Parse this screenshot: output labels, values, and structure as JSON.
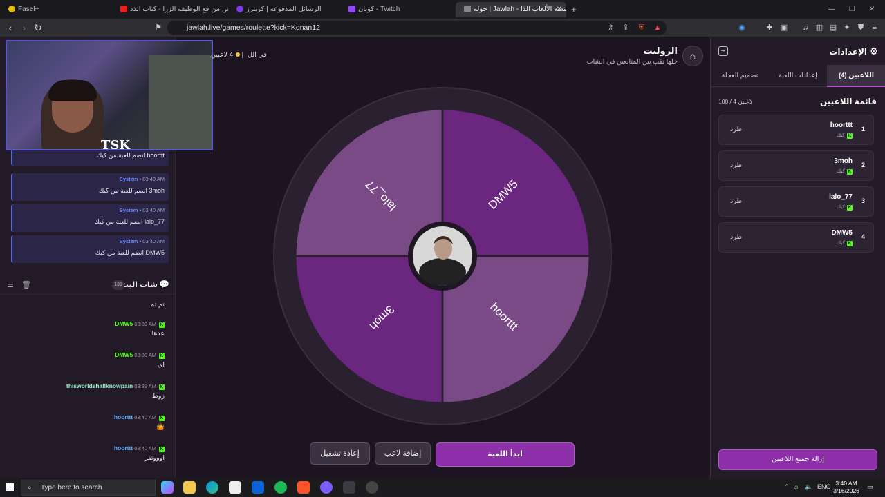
{
  "browser": {
    "tabs": [
      {
        "label": "Fasel+"
      },
      {
        "label": "تخلص من فع الوظيفة الزرا - كتاب الذد"
      },
      {
        "label": "الرسائل المدفوعة | كريترز"
      },
      {
        "label": "كونان - Twitch"
      },
      {
        "label": "جولة | Jawlah - منصة الألعاب الذا"
      }
    ],
    "new_tab": "+",
    "url": "jawlah.live/games/roulette?kick=Konan12"
  },
  "header": {
    "title": "الروليت",
    "subtitle": "خلها تقب بين المتابعين في الشات",
    "players_badge": "4 لاعبين",
    "players_badge_suffix": "في الل"
  },
  "wheel": {
    "segments": [
      {
        "name": "DMW5",
        "color": "#6b2680"
      },
      {
        "name": "hoorttt",
        "color": "#7a4a86"
      },
      {
        "name": "3moh",
        "color": "#6b2680"
      },
      {
        "name": "lalo_77",
        "color": "#7a4a86"
      }
    ]
  },
  "buttons": {
    "start": "ابدأ اللعبة",
    "add_player": "إضافة لاعب",
    "restart": "إعادة تشغيل"
  },
  "settings": {
    "title": "الإعدادات",
    "tabs": [
      "اللاعبين (4)",
      "إعدادات اللعبة",
      "تصميم العجلة"
    ],
    "list_title": "قائمة اللاعبين",
    "list_count": "100 / 4 لاعبين",
    "platform": "كيك",
    "kick_label": "طرد",
    "players": [
      {
        "num": "1",
        "name": "hoorttt"
      },
      {
        "num": "2",
        "name": "3moh"
      },
      {
        "num": "3",
        "name": "lalo_77"
      },
      {
        "num": "4",
        "name": "DMW5"
      }
    ],
    "remove_all": "إزالة جميع اللاعبين"
  },
  "chat": {
    "system_messages": [
      {
        "user": "",
        "time": "",
        "text": "hoorttt انضم للعبة من كيك"
      },
      {
        "user": "System",
        "time": "03:40 AM",
        "text": "3moh انضم للعبة من كيك"
      },
      {
        "user": "System",
        "time": "03:40 AM",
        "text": "lalo_77 انضم للعبة من كيك"
      },
      {
        "user": "System",
        "time": "03:40 AM",
        "text": "DMW5 انضم للعبة من كيك"
      }
    ],
    "title": "شات البث",
    "count": "131",
    "messages": [
      {
        "user": "",
        "time": "",
        "text": "تم تم",
        "color": "#53fc18"
      },
      {
        "user": "DMW5",
        "time": "03:39 AM",
        "text": "عدها",
        "color": "#53fc18"
      },
      {
        "user": "DMW5",
        "time": "03:39 AM",
        "text": "اي",
        "color": "#53fc18"
      },
      {
        "user": "thisworldshallknowpain",
        "time": "03:39 AM",
        "text": "زوط",
        "color": "#9be8c8"
      },
      {
        "user": "hoorttt",
        "time": "03:40 AM",
        "text": "🤷",
        "color": "#5fb0ff"
      },
      {
        "user": "hoorttt",
        "time": "03:40 AM",
        "text": "اوووتقر",
        "color": "#5fb0ff"
      }
    ]
  },
  "webcam": {
    "logo": "TSK"
  },
  "taskbar": {
    "search": "Type here to search",
    "lang": "ENG",
    "time": "3:40 AM",
    "date": "3/16/2026"
  }
}
